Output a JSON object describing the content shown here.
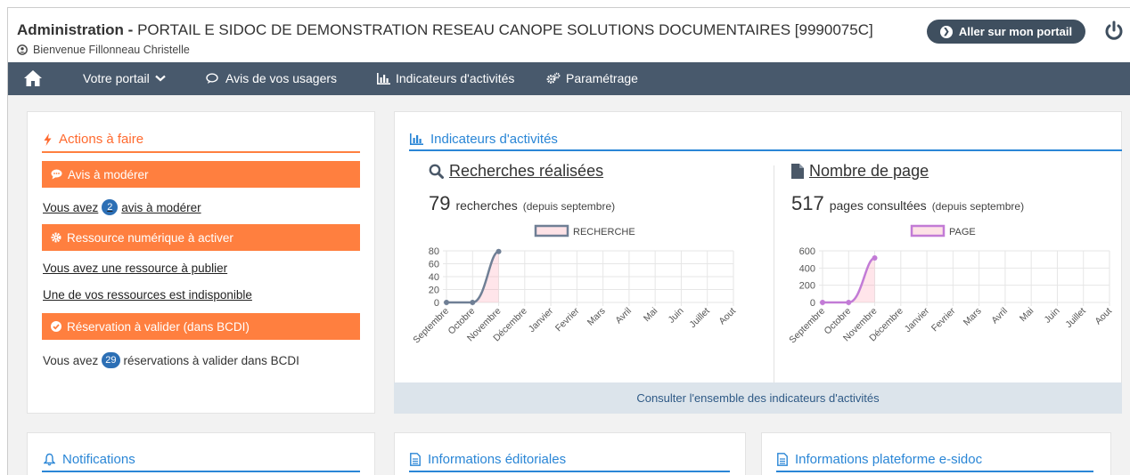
{
  "header": {
    "title_bold": "Administration -",
    "title_rest": "PORTAIL E SIDOC DE DEMONSTRATION RESEAU CANOPE SOLUTIONS DOCUMENTAIRES [9990075C]",
    "welcome": "Bienvenue Fillonneau Christelle",
    "portal_button": "Aller sur mon portail"
  },
  "nav": {
    "items": [
      "Votre portail",
      "Avis de vos usagers",
      "Indicateurs d'activités",
      "Paramétrage"
    ]
  },
  "actions": {
    "title": "Actions à faire",
    "bar1": "Avis à modérer",
    "link1_pre": "Vous avez",
    "link1_count": "2",
    "link1_post": "avis à modérer",
    "bar2": "Ressource numérique à activer",
    "link2": "Vous avez une ressource à publier",
    "link3": "Une de vos ressources est indisponible",
    "bar3": "Réservation à valider (dans BCDI)",
    "text4_pre": "Vous avez",
    "text4_count": "29",
    "text4_post": "réservations à valider dans BCDI"
  },
  "indicators": {
    "title": "Indicateurs d'activités",
    "consult": "Consulter l'ensemble des indicateurs d'activités",
    "searches": {
      "title": "Recherches réalisées",
      "count": "79",
      "word": "recherches",
      "since": "(depuis septembre)"
    },
    "pages": {
      "title": "Nombre de page",
      "count": "517",
      "word": "pages consultées",
      "since": "(depuis septembre)"
    }
  },
  "bottom": {
    "notifications": "Notifications",
    "editorial": "Informations éditoriales",
    "platform": "Informations plateforme e-sidoc"
  },
  "colors": {
    "orange": "#ff7f3f",
    "blue": "#2a86d6",
    "nav": "#48596c",
    "search_line": "#6f7f95",
    "page_line": "#c27bd6"
  },
  "chart_data": [
    {
      "type": "line",
      "categories": [
        "Septembre",
        "Octobre",
        "Novembre",
        "Décembre",
        "Janvier",
        "Fevrier",
        "Mars",
        "Avril",
        "Mai",
        "Juin",
        "Juillet",
        "Aout"
      ],
      "series": [
        {
          "name": "RECHERCHE",
          "values": [
            0,
            0,
            79
          ]
        }
      ],
      "ylim": [
        0,
        80
      ],
      "yticks": [
        0,
        20,
        40,
        60,
        80
      ],
      "grid": true,
      "legend": "top"
    },
    {
      "type": "line",
      "categories": [
        "Septembre",
        "Octobre",
        "Novembre",
        "Décembre",
        "Janvier",
        "Fevrier",
        "Mars",
        "Avril",
        "Mai",
        "Juin",
        "Juillet",
        "Aout"
      ],
      "series": [
        {
          "name": "PAGE",
          "values": [
            0,
            0,
            517
          ]
        }
      ],
      "ylim": [
        0,
        600
      ],
      "yticks": [
        0,
        200,
        400,
        600
      ],
      "grid": true,
      "legend": "top"
    }
  ]
}
